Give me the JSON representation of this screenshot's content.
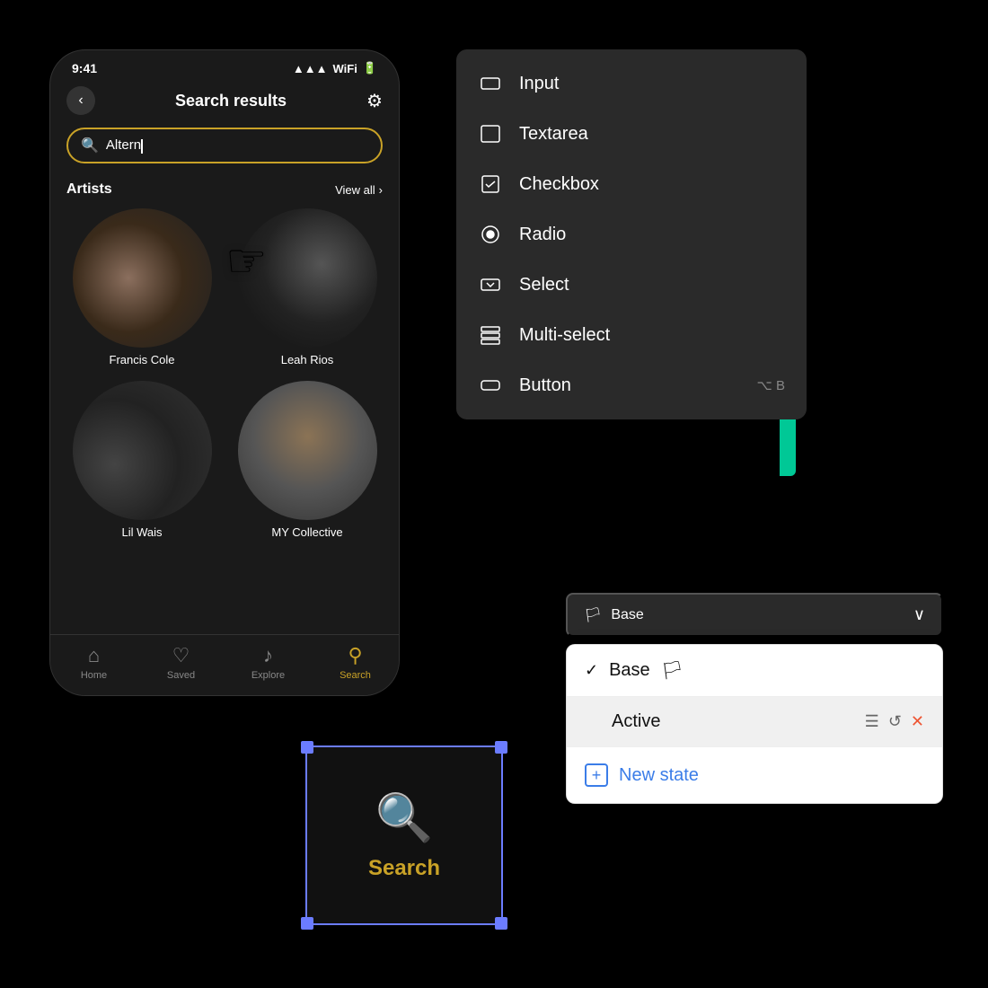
{
  "phone": {
    "status_time": "9:41",
    "header_title": "Search results",
    "search_value": "Altern",
    "section_artists": "Artists",
    "view_all": "View all",
    "artists": [
      {
        "name": "Francis Cole"
      },
      {
        "name": "Leah Rios"
      },
      {
        "name": "Lil Wais"
      },
      {
        "name": "MY Collective"
      }
    ],
    "nav_items": [
      {
        "label": "Home",
        "icon": "⌂",
        "active": false
      },
      {
        "label": "Saved",
        "icon": "♡",
        "active": false
      },
      {
        "label": "Explore",
        "icon": "♪",
        "active": false
      },
      {
        "label": "Search",
        "icon": "⚲",
        "active": true
      }
    ]
  },
  "dropdown": {
    "items": [
      {
        "label": "Input",
        "icon": "input",
        "shortcut": ""
      },
      {
        "label": "Textarea",
        "icon": "textarea",
        "shortcut": ""
      },
      {
        "label": "Checkbox",
        "icon": "checkbox",
        "shortcut": ""
      },
      {
        "label": "Radio",
        "icon": "radio",
        "shortcut": ""
      },
      {
        "label": "Select",
        "icon": "select",
        "shortcut": ""
      },
      {
        "label": "Multi-select",
        "icon": "multiselect",
        "shortcut": ""
      },
      {
        "label": "Button",
        "icon": "button",
        "shortcut": "⌥ B"
      }
    ]
  },
  "widget": {
    "label": "Search"
  },
  "state_panel": {
    "dropdown_label": "Base",
    "states": [
      {
        "label": "Base",
        "is_base": true,
        "active": false
      },
      {
        "label": "Active",
        "is_base": false,
        "active": true
      }
    ],
    "new_state_label": "New state"
  }
}
